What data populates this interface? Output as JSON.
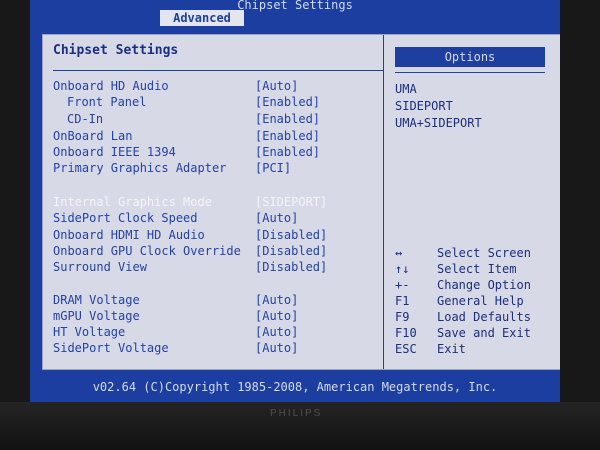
{
  "window": {
    "title": "Chipset Settings",
    "active_tab": "Advanced"
  },
  "left_panel": {
    "title": "Chipset Settings",
    "rows": [
      {
        "label": "Onboard HD Audio",
        "value": "[Auto]",
        "indent": false
      },
      {
        "label": "Front Panel",
        "value": "[Enabled]",
        "indent": true
      },
      {
        "label": "CD-In",
        "value": "[Enabled]",
        "indent": true
      },
      {
        "label": "OnBoard Lan",
        "value": "[Enabled]",
        "indent": false
      },
      {
        "label": "Onboard IEEE 1394",
        "value": "[Enabled]",
        "indent": false
      },
      {
        "label": "Primary Graphics Adapter",
        "value": "[PCI]",
        "indent": false
      },
      {
        "label": "Internal Graphics Mode",
        "value": "[SIDEPORT]",
        "indent": false,
        "highlight": true
      },
      {
        "label": "SidePort Clock Speed",
        "value": "[Auto]",
        "indent": false
      },
      {
        "label": "Onboard HDMI HD Audio",
        "value": "[Disabled]",
        "indent": false
      },
      {
        "label": "Onboard GPU Clock Override",
        "value": "[Disabled]",
        "indent": false
      },
      {
        "label": "Surround View",
        "value": "[Disabled]",
        "indent": false
      },
      {
        "label": "DRAM Voltage",
        "value": "[Auto]",
        "indent": false
      },
      {
        "label": "mGPU Voltage",
        "value": "[Auto]",
        "indent": false
      },
      {
        "label": "HT Voltage",
        "value": "[Auto]",
        "indent": false
      },
      {
        "label": "SidePort Voltage",
        "value": "[Auto]",
        "indent": false
      }
    ]
  },
  "right_panel": {
    "title": "Options",
    "options": [
      "UMA",
      "SIDEPORT",
      "UMA+SIDEPORT"
    ],
    "keys": [
      {
        "key": "↔",
        "desc": "Select Screen"
      },
      {
        "key": "↑↓",
        "desc": "Select Item"
      },
      {
        "key": "+-",
        "desc": "Change Option"
      },
      {
        "key": "F1",
        "desc": "General Help"
      },
      {
        "key": "F9",
        "desc": "Load Defaults"
      },
      {
        "key": "F10",
        "desc": "Save and Exit"
      },
      {
        "key": "ESC",
        "desc": "Exit"
      }
    ]
  },
  "footer": {
    "text": "v02.64 (C)Copyright 1985-2008, American Megatrends, Inc."
  },
  "monitor": {
    "brand": "PHILIPS"
  }
}
